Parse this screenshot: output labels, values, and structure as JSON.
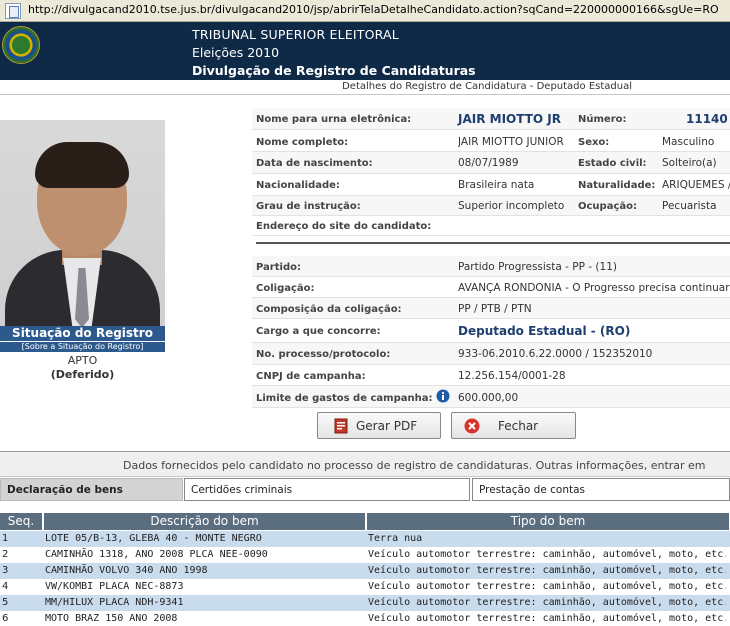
{
  "browser": {
    "url": "http://divulgacand2010.tse.jus.br/divulgacand2010/jsp/abrirTelaDetalheCandidato.action?sqCand=220000000166&sgUe=RO"
  },
  "header": {
    "org": "TRIBUNAL SUPERIOR ELEITORAL",
    "election": "Eleições 2010",
    "system": "Divulgação de Registro de Candidaturas",
    "subtitle": "Detalhes do Registro de Candidatura - Deputado Estadual"
  },
  "situacao": {
    "title": "Situação do Registro",
    "link": "[Sobre a Situação do Registro]",
    "status": "APTO",
    "detail": "(Deferido)"
  },
  "candidate": {
    "nome_urna_label": "Nome para urna eletrônica:",
    "nome_urna": "JAIR MIOTTO JR",
    "numero_label": "Número:",
    "numero": "11140",
    "nome_completo_label": "Nome completo:",
    "nome_completo": "JAIR MIOTTO JUNIOR",
    "sexo_label": "Sexo:",
    "sexo": "Masculino",
    "nascimento_label": "Data de nascimento:",
    "nascimento": "08/07/1989",
    "estado_civil_label": "Estado civil:",
    "estado_civil": "Solteiro(a)",
    "nacionalidade_label": "Nacionalidade:",
    "nacionalidade": "Brasileira nata",
    "naturalidade_label": "Naturalidade:",
    "naturalidade": "ARIQUEMES /",
    "instrucao_label": "Grau de instrução:",
    "instrucao": "Superior incompleto",
    "ocupacao_label": "Ocupação:",
    "ocupacao": "Pecuarista",
    "site_label": "Endereço do site do candidato:",
    "site": ""
  },
  "party": {
    "partido_label": "Partido:",
    "partido": "Partido Progressista - PP - (11)",
    "coligacao_label": "Coligação:",
    "coligacao": "AVANÇA RONDONIA - O Progresso precisa continuar",
    "composicao_label": "Composição da coligação:",
    "composicao": "PP / PTB / PTN",
    "cargo_label": "Cargo a que concorre:",
    "cargo": "Deputado Estadual - (RO)",
    "processo_label": "No. processo/protocolo:",
    "processo": "933-06.2010.6.22.0000 / 152352010",
    "cnpj_label": "CNPJ de campanha:",
    "cnpj": "12.256.154/0001-28",
    "limite_label": "Limite de gastos de campanha:",
    "limite": "600.000,00"
  },
  "buttons": {
    "pdf": "Gerar PDF",
    "close": "Fechar"
  },
  "info_text": "Dados fornecidos pelo candidato no processo de registro de candidaturas. Outras informações, entrar em",
  "tabs": [
    {
      "label": "Declaração de bens"
    },
    {
      "label": "Certidões criminais"
    },
    {
      "label": "Prestação de contas"
    }
  ],
  "table": {
    "headers": [
      "Seq.",
      "Descrição do bem",
      "Tipo do bem"
    ],
    "rows": [
      {
        "seq": "1",
        "desc": "LOTE 05/B-13, GLEBA 40 - MONTE NEGRO",
        "tipo": "Terra nua"
      },
      {
        "seq": "2",
        "desc": "CAMINHÃO 1318, ANO 2008 PLCA NEE-0090",
        "tipo": "Veículo automotor terrestre: caminhão, automóvel, moto, etc."
      },
      {
        "seq": "3",
        "desc": "CAMINHÃO VOLVO 340 ANO 1998",
        "tipo": "Veículo automotor terrestre: caminhão, automóvel, moto, etc."
      },
      {
        "seq": "4",
        "desc": "VW/KOMBI PLACA NEC-8873",
        "tipo": "Veículo automotor terrestre: caminhão, automóvel, moto, etc."
      },
      {
        "seq": "5",
        "desc": "MM/HILUX PLACA NDH-9341",
        "tipo": "Veículo automotor terrestre: caminhão, automóvel, moto, etc."
      },
      {
        "seq": "6",
        "desc": "MOTO BRAZ 150 ANO 2008",
        "tipo": "Veículo automotor terrestre: caminhão, automóvel, moto, etc."
      }
    ]
  },
  "colors": {
    "header_bg": "#0e2a47",
    "situacao_bg": "#2d5a8c",
    "table_header_bg": "#5b6e80",
    "row_alt_bg": "#c9dcee"
  }
}
